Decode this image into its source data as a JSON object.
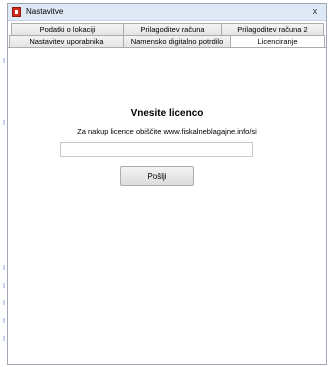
{
  "window": {
    "title": "Nastavitve",
    "close_label": "x"
  },
  "tabs": {
    "row1": [
      {
        "label": "Podatki o lokaciji"
      },
      {
        "label": "Prilagoditev računa"
      },
      {
        "label": "Prilagoditev računa 2"
      }
    ],
    "row2": [
      {
        "label": "Nastavitev uporabnika"
      },
      {
        "label": "Namensko digitalno potrdilo"
      },
      {
        "label": "Licenciranje",
        "active": true
      }
    ]
  },
  "license": {
    "heading": "Vnesite licenco",
    "info": "Za nakup licence obiščite www.fiskalneblagajne.info/si",
    "input_value": "",
    "input_placeholder": "",
    "submit_label": "Pošlji"
  }
}
